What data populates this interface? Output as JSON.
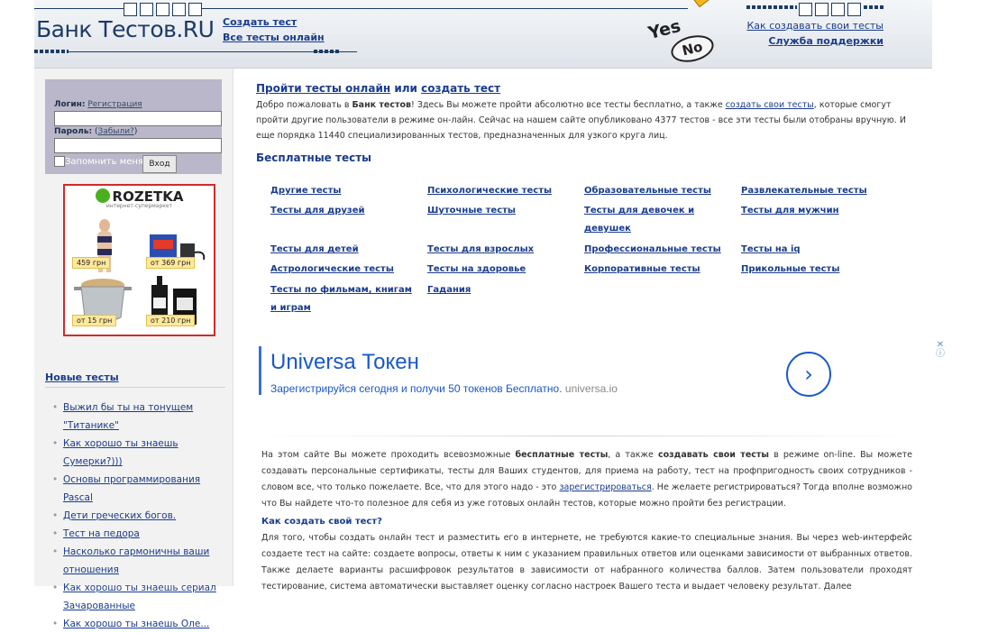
{
  "header": {
    "logo_text": "Банк Тестов.RU",
    "nav": [
      "Создать тест",
      "Все тесты онлайн"
    ],
    "yes": "Yes",
    "no": "No",
    "right_links": [
      "Как создавать свои тесты",
      "Служба поддержки"
    ]
  },
  "login": {
    "login_label": "Логин:",
    "register_link": "Регистрация",
    "password_label": "Пароль:",
    "forgot_link": "Забыли?",
    "remember": "Запомнить меня",
    "submit": "Вход"
  },
  "ad": {
    "brand": "ROZETKA",
    "tagline": "интернет-супермаркет",
    "prices": [
      "459 грн",
      "от 369 грн",
      "от 15 грн",
      "от 210 грн"
    ]
  },
  "new_tests": {
    "title": "Новые тесты",
    "items": [
      "Выжил бы ты на тонущем \"Титанике\"",
      "Как хорошо ты знаешь Сумерки?)))",
      "Основы программирования Pascal",
      "Дети греческих богов.",
      "Тест на педора",
      "Насколько гармоничны ваши отношения",
      "Как хорошо ты знаешь сериал Зачарованные",
      "Как хорошо ты знаешь Оле..."
    ]
  },
  "main": {
    "heading_link1": "Пройти тесты онлайн",
    "heading_or": " или ",
    "heading_link2": "создать тест",
    "intro_p1": "Добро пожаловать в ",
    "intro_brand": "Банк тестов",
    "intro_p2": "! Здесь Вы можете пройти абсолютно все тесты бесплатно, а также ",
    "intro_link": "создать свои тесты",
    "intro_p3": ", которые смогут пройти другие пользователи в режиме он-лайн. Сейчас на нашем сайте опубликовано 4377 тестов - все эти тесты были отобраны вручную. И еще порядка 11440 специализированных тестов, предназначенных для узкого круга лиц.",
    "free_heading": "Бесплатные тесты",
    "categories": [
      [
        "Другие тесты",
        "Психологические тесты",
        "Образовательные тесты",
        "Развлекательные тесты"
      ],
      [
        "Тесты для друзей",
        "Шуточные тесты",
        "Тесты для девочек и девушек",
        "Тесты для мужчин"
      ],
      [
        "Тесты для детей",
        "Тесты для взрослых",
        "Профессиональные тесты",
        "Тесты на iq"
      ],
      [
        "Астрологические тесты",
        "Тесты на здоровье",
        "Корпоративные тесты",
        "Прикольные тесты"
      ],
      [
        "Тесты по фильмам, книгам и играм",
        "Гадания",
        "",
        ""
      ]
    ],
    "google_ad": {
      "title": "Universa Токен",
      "desc": "Зарегистрируйся сегодня и получи 50 токенов Бесплатно. ",
      "domain": "universa.io"
    },
    "about_p1": "На этом сайте Вы можете проходить всевозможные ",
    "about_b1": "бесплатные тесты",
    "about_p2": ", а также ",
    "about_b2": "создавать свои тесты",
    "about_p3": " в режиме on-line. Вы можете создавать персональные сертификаты, тесты для Ваших студентов, для приема на работу, тест на профпригодность своих сотрудников - словом все, что только пожелаете. Все, что для этого надо - это ",
    "about_link": "зарегистрироваться",
    "about_p4": ". Не желаете регистрироваться? Тогда вполне возможно что Вы найдете что-то полезное для себя из уже готовых онлайн тестов, которые можно пройти без регистрации.",
    "how_heading": "Как создать свой тест?",
    "how_text": "Для того, чтобы создать онлайн тест и разместить его в интернете, не требуются какие-то специальные знания. Вы через web-интерфейс создаете тест на сайте: создаете вопросы, ответы к ним с указанием правильных ответов или оценками зависимости от выбранных ответов. Также делаете варианты расшифровок результатов в зависимости от набранного количества баллов. Затем пользователи проходят тестирование, система автоматически выставляет оценку согласно настроек Вашего теста и выдает человеку результат. Далее"
  }
}
